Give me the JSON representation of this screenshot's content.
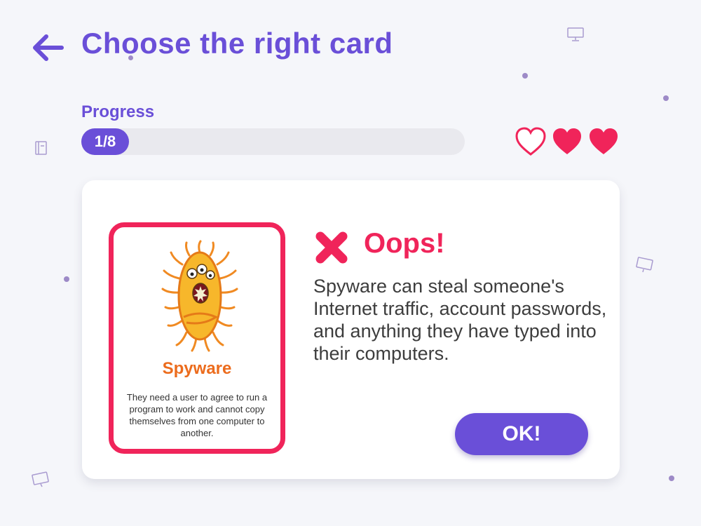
{
  "header": {
    "back_icon": "arrow-left-icon",
    "title": "Choose the right card"
  },
  "progress": {
    "label": "Progress",
    "text": "1/8",
    "current": 1,
    "total": 8
  },
  "lives": {
    "total": 3,
    "remaining": 2,
    "icons": [
      "heart-outline-icon",
      "heart-filled-icon",
      "heart-filled-icon"
    ]
  },
  "card": {
    "name": "Spyware",
    "description": "They need a user to agree to run a program to work and cannot copy themselves from one computer to another.",
    "image_icon": "virus-icon"
  },
  "feedback": {
    "icon": "x-icon",
    "heading": "Oops!",
    "message": "Spyware can steal someone's Internet traffic, account passwords, and anything they have typed into their computers."
  },
  "ok_label": "OK!",
  "colors": {
    "primary": "#6a4fd8",
    "error": "#f0245a",
    "card_title": "#ec6c1d",
    "background": "#f5f6fa"
  }
}
